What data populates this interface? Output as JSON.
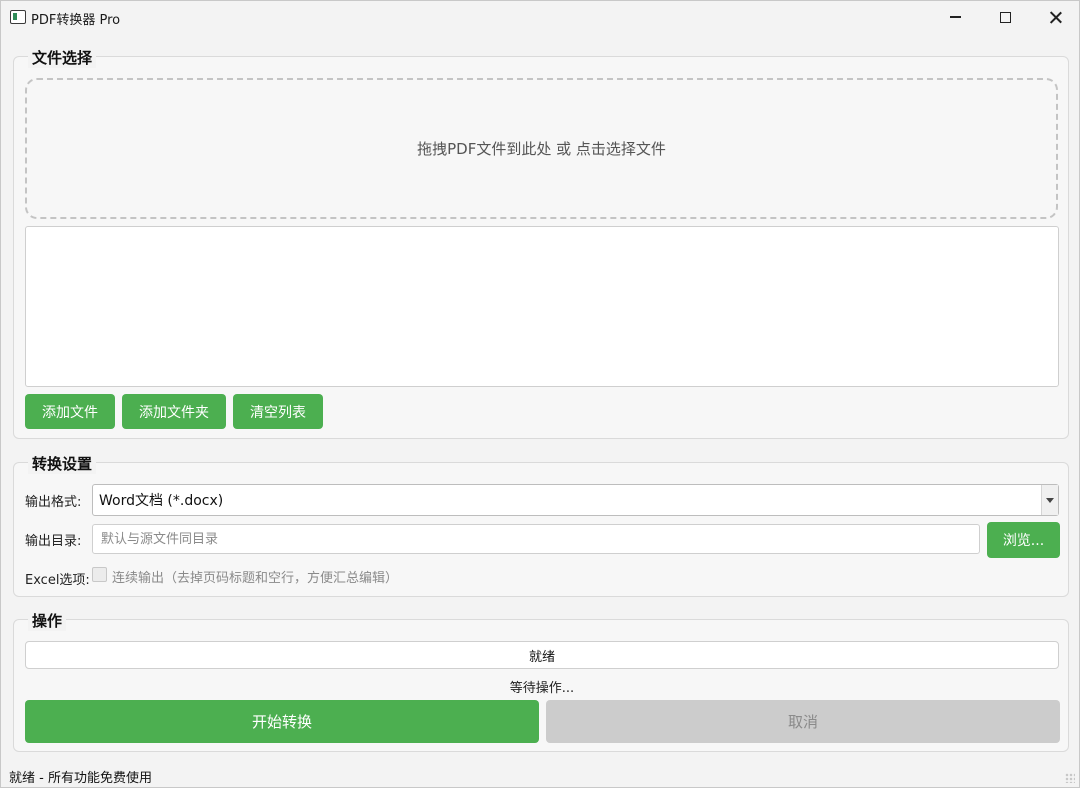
{
  "window": {
    "title": "PDF转换器 Pro"
  },
  "file_section": {
    "title": "文件选择",
    "dropzone_text": "拖拽PDF文件到此处 或 点击选择文件",
    "files": [],
    "buttons": {
      "add_file": "添加文件",
      "add_folder": "添加文件夹",
      "clear_list": "清空列表"
    }
  },
  "settings_section": {
    "title": "转换设置",
    "format_label": "输出格式:",
    "format_value": "Word文档 (*.docx)",
    "dir_label": "输出目录:",
    "dir_value": "",
    "dir_placeholder": "默认与源文件同目录",
    "browse_label": "浏览...",
    "excel_label": "Excel选项:",
    "excel_checkbox_label": "连续输出（去掉页码标题和空行，方便汇总编辑）",
    "excel_checked": false
  },
  "action_section": {
    "title": "操作",
    "progress_text": "就绪",
    "progress_value": 0,
    "status_text": "等待操作...",
    "start_label": "开始转换",
    "cancel_label": "取消"
  },
  "statusbar": {
    "text": "就绪 - 所有功能免费使用"
  },
  "colors": {
    "accent": "#4caf50",
    "disabled": "#cccccc"
  }
}
